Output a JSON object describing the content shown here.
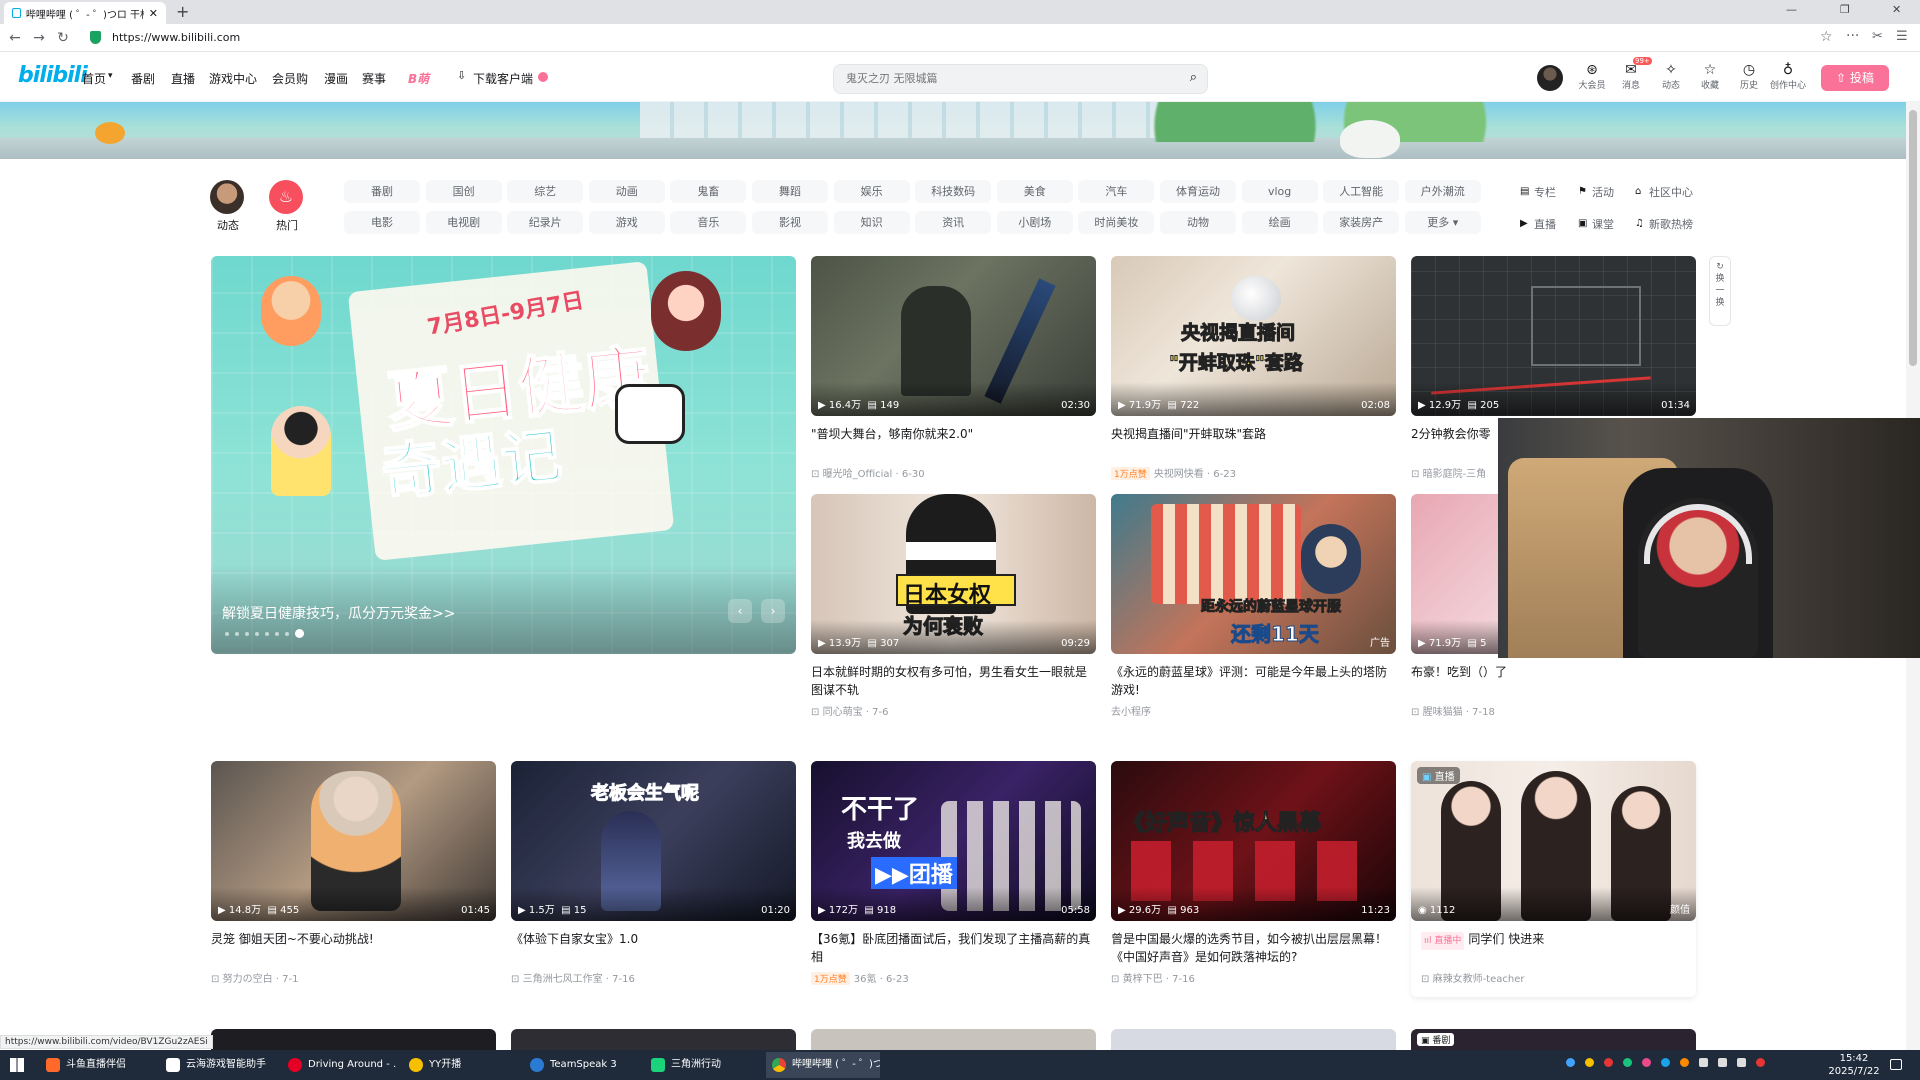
{
  "browser": {
    "tab_title": "哔哩哔哩 ( ゜- ゜)つロ 干杯~-",
    "url": "https://www.bilibili.com",
    "status_link": "https://www.bilibili.com/video/BV1ZGu2zAESi"
  },
  "header": {
    "logo": "bilibili",
    "nav": [
      "首页",
      "番剧",
      "直播",
      "游戏中心",
      "会员购",
      "漫画",
      "赛事",
      "B萌",
      "下载客户端"
    ],
    "search_placeholder": "鬼灭之刃 无限城篇",
    "icons": [
      {
        "label": "大会员",
        "icon": "vip-icon"
      },
      {
        "label": "消息",
        "icon": "message-icon",
        "badge": "99+"
      },
      {
        "label": "动态",
        "icon": "dynamic-icon"
      },
      {
        "label": "收藏",
        "icon": "favorite-icon"
      },
      {
        "label": "历史",
        "icon": "history-icon"
      },
      {
        "label": "创作中心",
        "icon": "creator-icon"
      }
    ],
    "upload": "投稿"
  },
  "channels": {
    "dynamic": "动态",
    "hot": "热门",
    "row1": [
      "番剧",
      "国创",
      "综艺",
      "动画",
      "鬼畜",
      "舞蹈",
      "娱乐",
      "科技数码",
      "美食",
      "汽车",
      "体育运动",
      "vlog",
      "人工智能",
      "户外潮流"
    ],
    "row2": [
      "电影",
      "电视剧",
      "纪录片",
      "游戏",
      "音乐",
      "影视",
      "知识",
      "资讯",
      "小剧场",
      "时尚美妆",
      "动物",
      "绘画",
      "家装房产",
      "更多"
    ],
    "side": [
      "专栏",
      "活动",
      "社区中心",
      "直播",
      "课堂",
      "新歌热榜"
    ]
  },
  "carousel": {
    "caption": "解锁夏日健康技巧，瓜分万元奖金>>",
    "art_date": "7月8日-9月7日",
    "art_title1": "夏日健康",
    "art_title2": "奇遇记"
  },
  "refresh_label": "换一换",
  "cards": [
    {
      "views": "16.4万",
      "danmaku": "149",
      "duration": "02:30",
      "title": "\"普坝大舞台，够南你就来2.0\"",
      "author": "曝光哈_Official",
      "date": "6-30",
      "tag": ""
    },
    {
      "views": "71.9万",
      "danmaku": "722",
      "duration": "02:08",
      "title": "央视揭直播间\"开蚌取珠\"套路",
      "author": "央视网快看",
      "date": "6-23",
      "tag": "1万点赞",
      "overlay1": "央视揭直播间",
      "overlay2": "\"开蚌取珠\"套路"
    },
    {
      "views": "12.9万",
      "danmaku": "205",
      "duration": "01:34",
      "title": "2分钟教会你零",
      "author": "暗影庭院-三角",
      "date": "",
      "tag": ""
    },
    {
      "views": "13.9万",
      "danmaku": "307",
      "duration": "09:29",
      "title": "日本就鲜时期的女权有多可怕，男生看女生一眼就是图谋不轨",
      "author": "同心萌宝",
      "date": "7-6",
      "tag": "",
      "overlay1": "日本女权",
      "overlay2": "为何衰败"
    },
    {
      "views": "",
      "danmaku": "",
      "duration": "",
      "ad": "广告",
      "title": "《永远的蔚蓝星球》评测：可能是今年最上头的塔防游戏!",
      "author": "去小程序",
      "date": "",
      "tag": "",
      "overlay1": "距永远的蔚蓝星球开服",
      "overlay2": "还剩11天"
    },
    {
      "views": "71.9万",
      "danmaku": "5",
      "duration": "",
      "title": "布豪！吃到（）了",
      "author": "腥味猫猫",
      "date": "7-18",
      "tag": ""
    },
    {
      "views": "14.8万",
      "danmaku": "455",
      "duration": "01:45",
      "title": "灵笼 御姐天团~不要心动挑战!",
      "author": "努力の空白",
      "date": "7-1",
      "tag": ""
    },
    {
      "views": "1.5万",
      "danmaku": "15",
      "duration": "01:20",
      "title": "《体验下自家女宝》1.0",
      "author": "三角洲七风工作室",
      "date": "7-16",
      "tag": "",
      "overlay1": "老板会生气呢"
    },
    {
      "views": "172万",
      "danmaku": "918",
      "duration": "05:58",
      "title": "【36氪】卧底团播面试后，我们发现了主播高薪的真相",
      "author": "36氪",
      "date": "6-23",
      "tag": "1万点赞",
      "overlay1": "不干了",
      "overlay2": "我去做",
      "overlay3": "▶▶团播"
    },
    {
      "views": "29.6万",
      "danmaku": "963",
      "duration": "11:23",
      "title": "曾是中国最火爆的选秀节目，如今被扒出层层黑幕！《中国好声音》是如何跌落神坛的?",
      "author": "黄梓下巴",
      "date": "7-16",
      "tag": "",
      "overlay1": "《好声音》惊人黑幕"
    },
    {
      "views": "1112",
      "danmaku": "",
      "duration": "",
      "live_badge": "直播",
      "ad": "颜值",
      "title": "同学们 快进来",
      "author": "麻辣女教师-teacher",
      "date": "",
      "tag": "直播中"
    }
  ],
  "bottom_live_badge": "番剧",
  "taskbar": {
    "items": [
      "斗鱼直播伴侣",
      "云海游戏智能助手",
      "Driving Around - ...",
      "YY开播",
      "TeamSpeak 3",
      "三角洲行动",
      "哔哩哔哩 ( ゜- ゜)つロ..."
    ],
    "time": "15:42",
    "date": "2025/7/22"
  },
  "colors": {
    "accent": "#00aeec",
    "pink": "#fb7299"
  }
}
